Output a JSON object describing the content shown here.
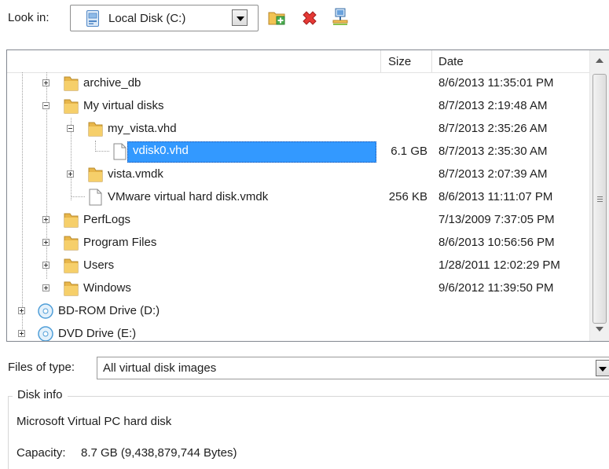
{
  "look_in": {
    "label": "Look in:",
    "value": "Local Disk (C:)",
    "icon": "local-disk-icon"
  },
  "toolbar": {
    "new_folder_icon": "new-folder-icon",
    "delete_icon": "delete-icon",
    "network_icon": "network-icon"
  },
  "columns": {
    "size": "Size",
    "date": "Date"
  },
  "tree": [
    {
      "name": "archive_db",
      "size": "",
      "date": "8/6/2013 11:35:01 PM",
      "type": "folder",
      "expander": "plus"
    },
    {
      "name": "My virtual disks",
      "size": "",
      "date": "8/7/2013 2:19:48 AM",
      "type": "folder",
      "expander": "minus"
    },
    {
      "name": "my_vista.vhd",
      "size": "",
      "date": "8/7/2013 2:35:26 AM",
      "type": "folder",
      "expander": "minus"
    },
    {
      "name": "vdisk0.vhd",
      "size": "6.1 GB",
      "date": "8/7/2013 2:35:30 AM",
      "type": "file",
      "selected": true
    },
    {
      "name": "vista.vmdk",
      "size": "",
      "date": "8/7/2013 2:07:39 AM",
      "type": "folder",
      "expander": "plus"
    },
    {
      "name": "VMware virtual hard disk.vmdk",
      "size": "256 KB",
      "date": "8/6/2013 11:11:07 PM",
      "type": "file"
    },
    {
      "name": "PerfLogs",
      "size": "",
      "date": "7/13/2009 7:37:05 PM",
      "type": "folder",
      "expander": "plus"
    },
    {
      "name": "Program Files",
      "size": "",
      "date": "8/6/2013 10:56:56 PM",
      "type": "folder",
      "expander": "plus"
    },
    {
      "name": "Users",
      "size": "",
      "date": "1/28/2011 12:02:29 PM",
      "type": "folder",
      "expander": "plus"
    },
    {
      "name": "Windows",
      "size": "",
      "date": "9/6/2012 11:39:50 PM",
      "type": "folder",
      "expander": "plus"
    },
    {
      "name": "BD-ROM Drive (D:)",
      "size": "",
      "date": "",
      "type": "optical",
      "expander": "plus"
    },
    {
      "name": "DVD Drive (E:)",
      "size": "",
      "date": "",
      "type": "optical",
      "expander": "plus"
    }
  ],
  "files_of_type": {
    "label": "Files of type:",
    "value": "All virtual disk images"
  },
  "disk_info": {
    "title": "Disk info",
    "description": "Microsoft Virtual PC hard disk",
    "capacity_label": "Capacity:",
    "capacity_value": "8.7 GB (9,438,879,744 Bytes)"
  },
  "colors": {
    "selection": "#3399ff",
    "folder": "#e8b64a"
  }
}
